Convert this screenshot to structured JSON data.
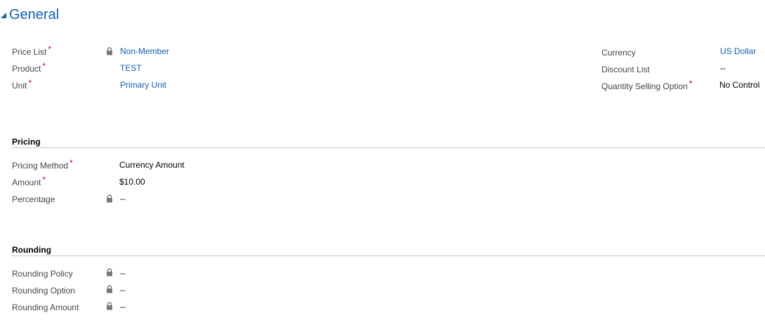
{
  "general": {
    "title": "General",
    "left_fields": [
      {
        "label": "Price List",
        "required": "*",
        "value": "Non-Member",
        "locked": true,
        "link": true
      },
      {
        "label": "Product",
        "required": "*",
        "value": "TEST",
        "locked": false,
        "link": true
      },
      {
        "label": "Unit",
        "required": "*",
        "value": "Primary Unit",
        "locked": false,
        "link": true
      }
    ],
    "right_fields": [
      {
        "label": "Currency",
        "value": "US Dollar",
        "link": true
      },
      {
        "label": "Discount List",
        "value": "--",
        "link": false
      },
      {
        "label": "Quantity Selling Option",
        "required": "*",
        "value": "No Control",
        "link": false
      }
    ]
  },
  "pricing": {
    "title": "Pricing",
    "fields": [
      {
        "label": "Pricing Method",
        "required": "*",
        "value": "Currency Amount"
      },
      {
        "label": "Amount",
        "required": "*",
        "value": "$10.00"
      },
      {
        "label": "Percentage",
        "value": "--",
        "locked": true
      }
    ]
  },
  "rounding": {
    "title": "Rounding",
    "fields": [
      {
        "label": "Rounding Policy",
        "value": "--",
        "locked": true
      },
      {
        "label": "Rounding Option",
        "value": "--",
        "locked": true
      },
      {
        "label": "Rounding Amount",
        "value": "--",
        "locked": true
      }
    ]
  },
  "colors": {
    "accent": "#1160b7",
    "required": "#d0021b",
    "label": "#444444",
    "rule": "#c8c8c8"
  },
  "icons": {
    "collapse": "caret-triangle-icon",
    "lock": "lock-icon"
  }
}
